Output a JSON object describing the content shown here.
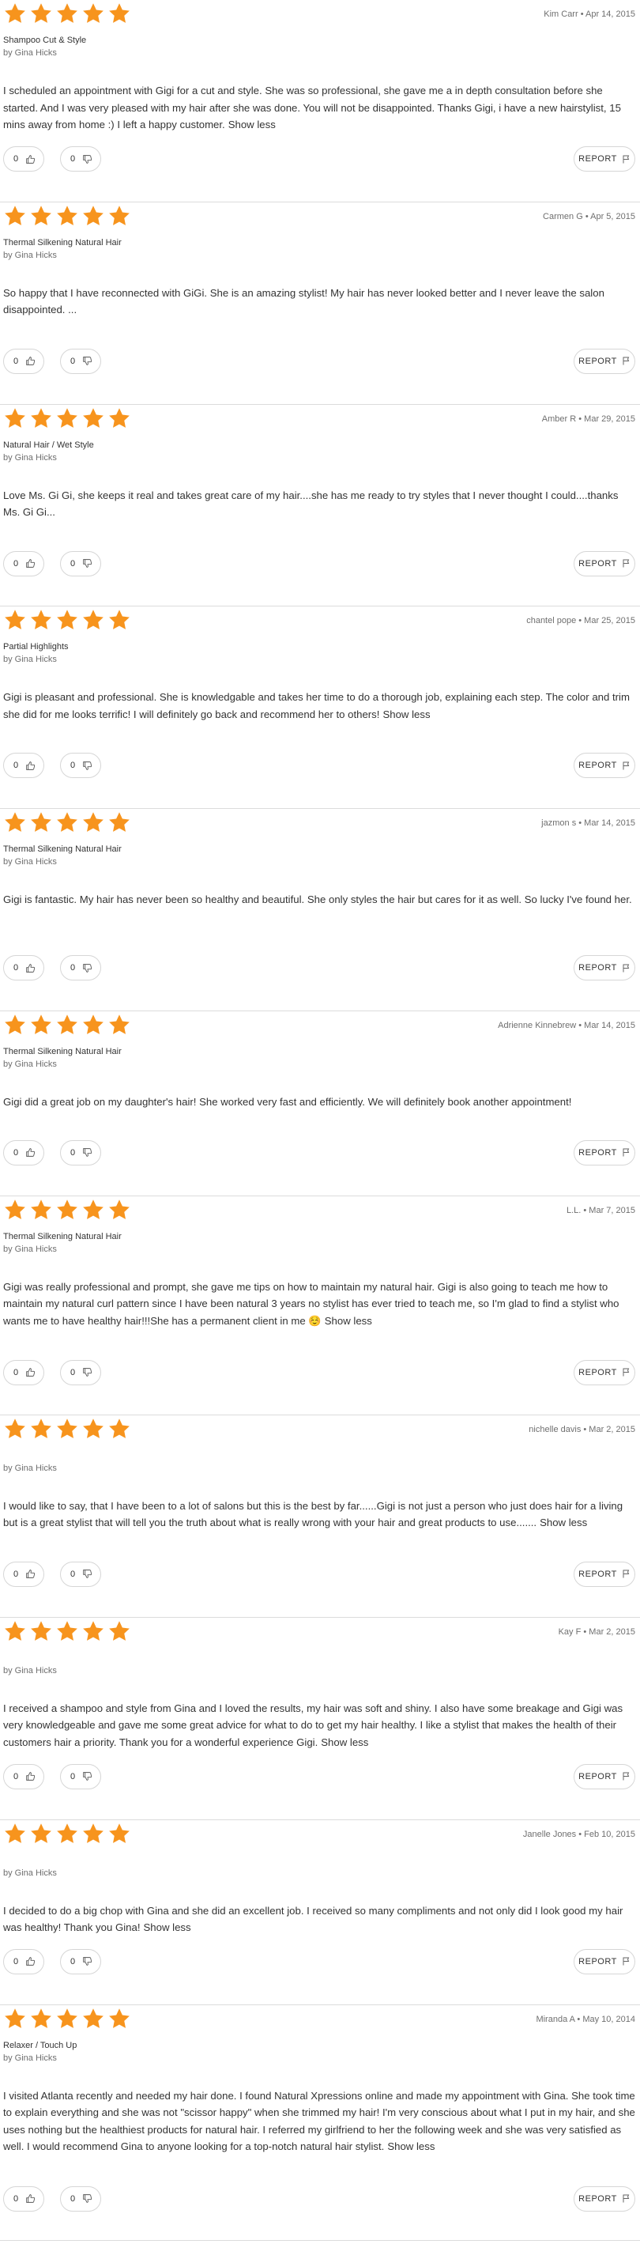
{
  "colors": {
    "star": "#f7941d",
    "border": "#dcdcdc",
    "text": "#333333",
    "muted": "#6f6f6f"
  },
  "icons": {
    "rating": "star-icon",
    "upvote": "thumbs-up-icon",
    "downvote": "thumbs-down-icon",
    "report": "flag-icon"
  },
  "labels": {
    "report": "REPORT",
    "show_less": "Show less"
  },
  "reviews": [
    {
      "rating": 5,
      "reviewer": "Kim Carr",
      "date": "Apr 14, 2015",
      "service": "Shampoo Cut & Style",
      "staff": "by Gina Hicks",
      "text": "I scheduled an appointment with Gigi for a cut and style. She was so professional, she gave me a in depth consultation before she started. And I was very pleased with my hair after she was done. You will not be disappointed. Thanks Gigi, i have a new hairstylist, 15 mins away from home :) I left a happy customer.",
      "show_less": "Show less",
      "helpful": "0",
      "not_helpful": "0"
    },
    {
      "rating": 5,
      "reviewer": "Carmen G",
      "date": "Apr 5, 2015",
      "service": "Thermal Silkening Natural Hair",
      "staff": "by Gina Hicks",
      "text": "So happy that I have reconnected with GiGi. She is an amazing stylist! My hair has never looked better and I never leave the salon disappointed. ...",
      "show_less": "",
      "helpful": "0",
      "not_helpful": "0"
    },
    {
      "rating": 5,
      "reviewer": "Amber R",
      "date": "Mar 29, 2015",
      "service": "Natural Hair / Wet Style",
      "staff": "by Gina Hicks",
      "text": "Love Ms. Gi Gi, she keeps it real and takes great care of my hair....she has me ready to try styles that I never thought I could....thanks Ms. Gi Gi...",
      "show_less": "",
      "helpful": "0",
      "not_helpful": "0"
    },
    {
      "rating": 5,
      "reviewer": "chantel pope",
      "date": "Mar 25, 2015",
      "service": "Partial Highlights",
      "staff": "by Gina Hicks",
      "text": "Gigi is pleasant and professional. She is knowledgable and takes her time to do a thorough job, explaining each step. The color and trim she did for me looks terrific! I will definitely go back and recommend her to others!",
      "show_less": "Show less",
      "helpful": "0",
      "not_helpful": "0"
    },
    {
      "rating": 5,
      "reviewer": "jazmon s",
      "date": "Mar 14, 2015",
      "service": "Thermal Silkening Natural Hair",
      "staff": "by Gina Hicks",
      "text": "Gigi is fantastic. My hair has never been so healthy and beautiful. She only styles the hair but cares for it as well. So lucky I've found her.",
      "show_less": "",
      "helpful": "0",
      "not_helpful": "0"
    },
    {
      "rating": 5,
      "reviewer": "Adrienne Kinnebrew",
      "date": "Mar 14, 2015",
      "service": "Thermal Silkening Natural Hair",
      "staff": "by Gina Hicks",
      "text": "Gigi did a great job on my daughter's hair! She worked very fast and efficiently. We will definitely book another appointment!",
      "show_less": "",
      "helpful": "0",
      "not_helpful": "0"
    },
    {
      "rating": 5,
      "reviewer": "L.L.",
      "date": "Mar 7, 2015",
      "service": "Thermal Silkening Natural Hair",
      "staff": "by Gina Hicks",
      "text": "Gigi was really professional and prompt, she gave me tips on how to maintain my natural hair. Gigi is also going to teach me how to maintain my natural curl pattern since I have been natural 3 years no stylist has ever tried to teach me, so I'm glad to find a stylist who wants me to have healthy hair!!!She has a permanent client in me ☺️",
      "show_less": "Show less",
      "helpful": "0",
      "not_helpful": "0"
    },
    {
      "rating": 5,
      "reviewer": "nichelle davis",
      "date": "Mar 2, 2015",
      "service": "",
      "staff": "by Gina Hicks",
      "text": "I would like to say, that I have been to a lot of salons but this is the best by far......Gigi is not just a person who just does hair for a living but is a great stylist that will tell you the truth about what is really wrong with your hair and great products to use.......",
      "show_less": "Show less",
      "helpful": "0",
      "not_helpful": "0"
    },
    {
      "rating": 5,
      "reviewer": "Kay F",
      "date": "Mar 2, 2015",
      "service": "",
      "staff": "by Gina Hicks",
      "text": "I received a shampoo and style from Gina and I loved the results, my hair was soft and shiny. I also have some breakage and Gigi was very knowledgeable and gave me some great advice for what to do to get my hair healthy. I like a stylist that makes the health of their customers hair a priority. Thank you for a wonderful experience Gigi.",
      "show_less": "Show less",
      "helpful": "0",
      "not_helpful": "0"
    },
    {
      "rating": 5,
      "reviewer": "Janelle Jones",
      "date": "Feb 10, 2015",
      "service": "",
      "staff": "by Gina Hicks",
      "text": "I decided to do a big chop with Gina and she did an excellent job. I received so many compliments and not only did I look good my hair was healthy! Thank you Gina!",
      "show_less": "Show less",
      "helpful": "0",
      "not_helpful": "0"
    },
    {
      "rating": 5,
      "reviewer": "Miranda A",
      "date": "May 10, 2014",
      "service": "Relaxer / Touch Up",
      "staff": "by Gina Hicks",
      "text": "I visited Atlanta recently and needed my hair done. I found Natural Xpressions online and made my appointment with Gina. She took time to explain everything and she was not \"scissor happy\" when she trimmed my hair! I'm very conscious about what I put in my hair, and she uses nothing but the healthiest products for natural hair. I referred my girlfriend to her the following week and she was very satisfied as well. I would recommend Gina to anyone looking for a top-notch natural hair stylist.",
      "show_less": "Show less",
      "helpful": "0",
      "not_helpful": "0"
    }
  ]
}
